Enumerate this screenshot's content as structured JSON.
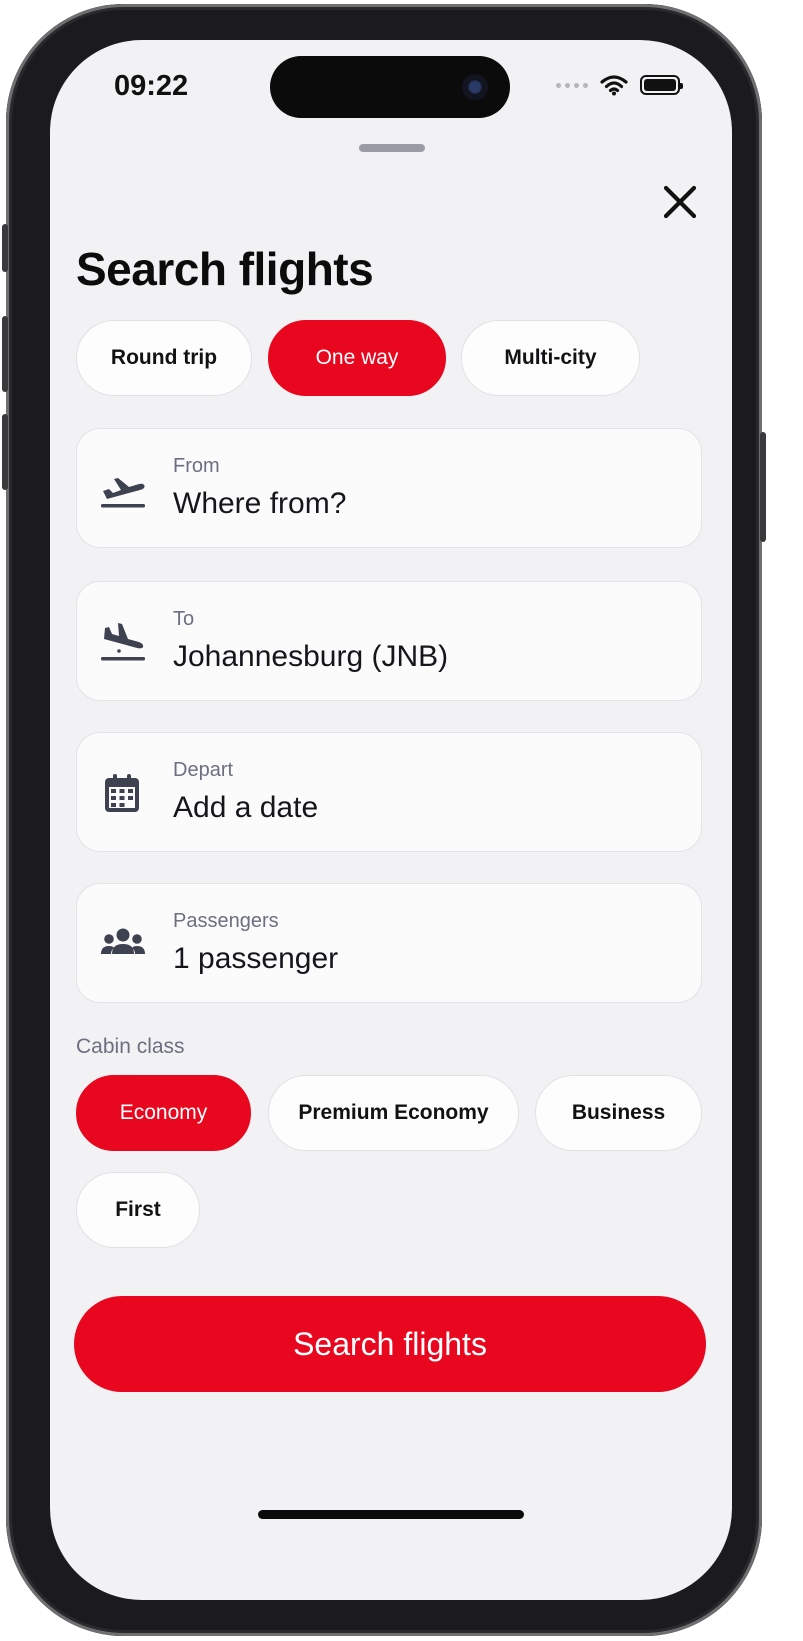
{
  "status_bar": {
    "time": "09:22"
  },
  "header": {
    "title": "Search flights"
  },
  "trip_types": [
    {
      "label": "Round trip",
      "selected": false
    },
    {
      "label": "One way",
      "selected": true
    },
    {
      "label": "Multi-city",
      "selected": false
    }
  ],
  "fields": {
    "from": {
      "label": "From",
      "value": "Where from?",
      "icon": "takeoff-icon"
    },
    "to": {
      "label": "To",
      "value": "Johannesburg (JNB)",
      "icon": "landing-icon"
    },
    "depart": {
      "label": "Depart",
      "value": "Add a date",
      "icon": "calendar-icon"
    },
    "passengers": {
      "label": "Passengers",
      "value": "1 passenger",
      "icon": "people-icon"
    }
  },
  "cabin": {
    "label": "Cabin class",
    "options": [
      {
        "label": "Economy",
        "selected": true
      },
      {
        "label": "Premium Economy",
        "selected": false
      },
      {
        "label": "Business",
        "selected": false
      },
      {
        "label": "First",
        "selected": false
      }
    ]
  },
  "cta": {
    "label": "Search flights"
  },
  "colors": {
    "accent": "#e8071f",
    "background": "#f2f2f4",
    "muted_text": "#6b7080"
  }
}
